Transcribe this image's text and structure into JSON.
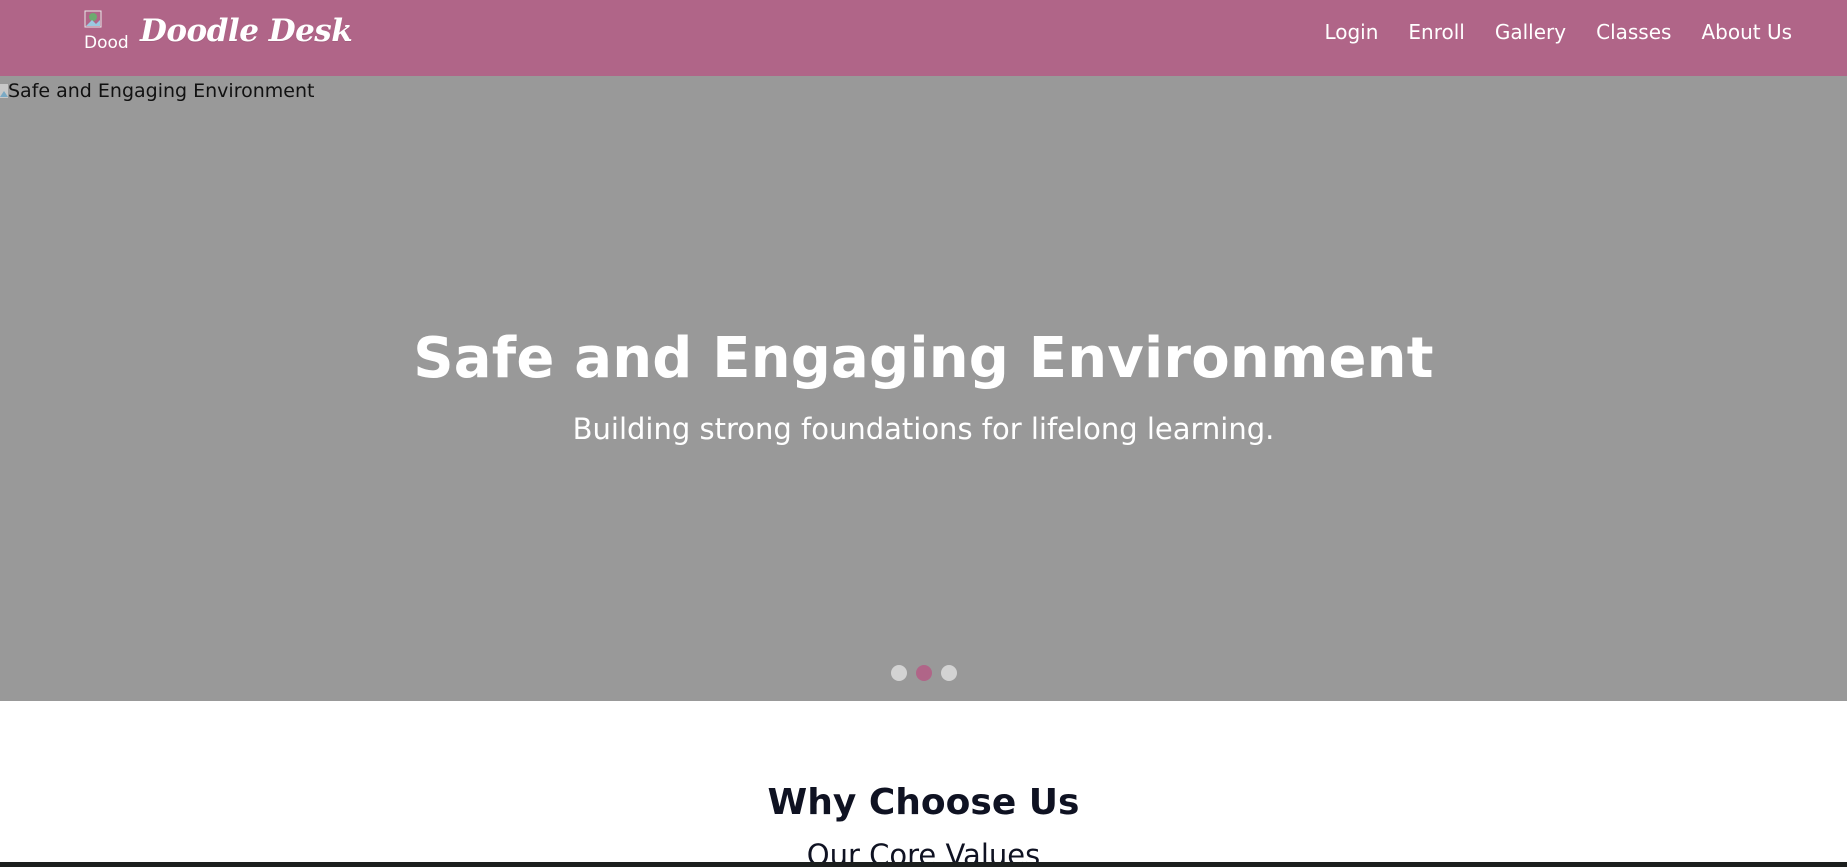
{
  "header": {
    "logo_alt": "Doodle Desk logo",
    "logo_alt_visible": "Dood",
    "brand_name": "Doodle Desk",
    "background_color": "#b06588",
    "nav": [
      {
        "label": "Login"
      },
      {
        "label": "Enroll"
      },
      {
        "label": "Gallery"
      },
      {
        "label": "Classes"
      },
      {
        "label": "About Us"
      }
    ]
  },
  "hero": {
    "image_alt": "Safe and Engaging Environment",
    "title": "Safe and Engaging Environment",
    "subtitle": "Building strong foundations for lifelong learning.",
    "slides_count": 3,
    "active_slide": 2,
    "background_color": "#999999"
  },
  "section": {
    "title": "Why Choose Us",
    "subtitle": "Our Core Values"
  },
  "icons": {
    "logo": "broken-image-icon",
    "hero_image": "broken-image-icon"
  }
}
